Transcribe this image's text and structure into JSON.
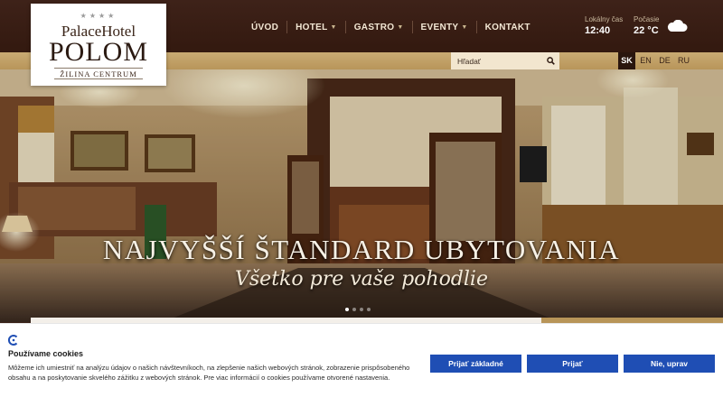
{
  "logo": {
    "stars": "★★★★",
    "line1": "PalaceHotel",
    "line2": "POLOM",
    "line3": "ŽILINA CENTRUM"
  },
  "nav": {
    "items": [
      {
        "label": "ÚVOD",
        "dropdown": false
      },
      {
        "label": "HOTEL",
        "dropdown": true
      },
      {
        "label": "GASTRO",
        "dropdown": true
      },
      {
        "label": "EVENTY",
        "dropdown": true
      },
      {
        "label": "KONTAKT",
        "dropdown": false
      }
    ]
  },
  "clock": {
    "label": "Lokálny čas",
    "value": "12:40"
  },
  "weather": {
    "label": "Počasie",
    "value": "22 °C",
    "icon": "cloud-icon"
  },
  "search": {
    "placeholder": "Hľadať",
    "icon": "search-icon"
  },
  "languages": {
    "items": [
      "SK",
      "EN",
      "DE",
      "RU"
    ],
    "active": "SK"
  },
  "hero": {
    "title": "NAJVYŠŠÍ ŠTANDARD UBYTOVANIA",
    "subtitle": "Všetko pre vaše pohodlie",
    "slides_total": 4,
    "slide_active": 1
  },
  "cookie": {
    "title": "Používame cookies",
    "text": "Môžeme ich umiestniť na analýzu údajov o našich návštevníkoch, na zlepšenie našich webových stránok, zobrazenie prispôsobeného obsahu a na poskytovanie skvelého zážitku z webových stránok. Pre viac informácií o cookies používame otvorené nastavenia.",
    "buttons": {
      "accept_basic": "Prijať základné",
      "accept": "Prijať",
      "decline": "Nie, uprav"
    },
    "button_color": "#1f4eb4"
  },
  "colors": {
    "header": "#3a1f16",
    "gold": "#c2a268",
    "accent_dark": "#2a160e"
  }
}
